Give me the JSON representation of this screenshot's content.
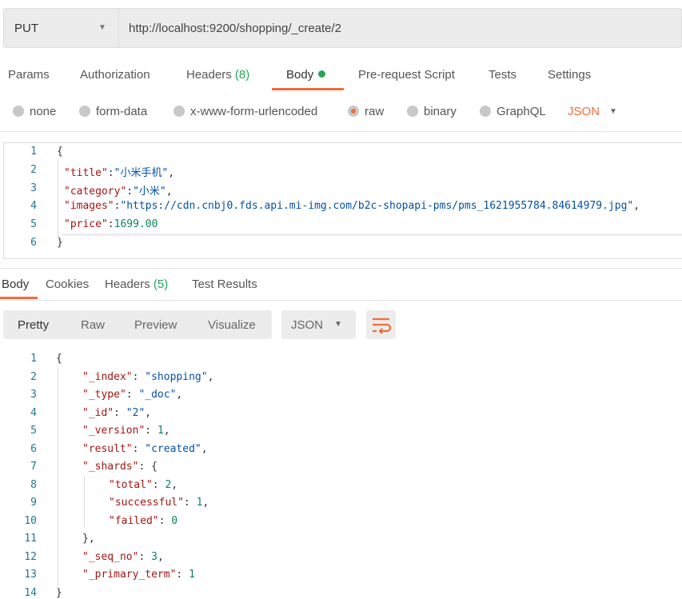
{
  "request": {
    "method": "PUT",
    "url": "http://localhost:9200/shopping/_create/2"
  },
  "req_tabs": [
    {
      "label": "Params"
    },
    {
      "label": "Authorization"
    },
    {
      "label": "Headers",
      "count": "(8)"
    },
    {
      "label": "Body",
      "active": true
    },
    {
      "label": "Pre-request Script"
    },
    {
      "label": "Tests"
    },
    {
      "label": "Settings"
    }
  ],
  "body_types": [
    {
      "label": "none"
    },
    {
      "label": "form-data"
    },
    {
      "label": "x-www-form-urlencoded"
    },
    {
      "label": "raw",
      "selected": true
    },
    {
      "label": "binary"
    },
    {
      "label": "GraphQL"
    }
  ],
  "body_format": "JSON",
  "request_body": [
    {
      "indent": 0,
      "tokens": [
        [
          "{",
          "p"
        ]
      ]
    },
    {
      "indent": 1,
      "tokens": [
        [
          "\"title\"",
          "k"
        ],
        [
          ":",
          "p"
        ],
        [
          "\"小米手机\"",
          "s"
        ],
        [
          ",",
          "p"
        ]
      ]
    },
    {
      "indent": 1,
      "tokens": [
        [
          "\"category\"",
          "k"
        ],
        [
          ":",
          "p"
        ],
        [
          "\"小米\"",
          "s"
        ],
        [
          ",",
          "p"
        ]
      ]
    },
    {
      "indent": 1,
      "tokens": [
        [
          "\"images\"",
          "k"
        ],
        [
          ":",
          "p"
        ],
        [
          "\"https://cdn.cnbj0.fds.api.mi-img.com/b2c-shopapi-pms/pms_1621955784.84614979.jpg\"",
          "s"
        ],
        [
          ",",
          "p"
        ]
      ]
    },
    {
      "indent": 1,
      "tokens": [
        [
          "\"price\"",
          "k"
        ],
        [
          ":",
          "p"
        ],
        [
          "1699.00",
          "n"
        ]
      ]
    },
    {
      "indent": 0,
      "tokens": [
        [
          "}",
          "p"
        ]
      ]
    }
  ],
  "resp_tabs": [
    {
      "label": "Body",
      "active": true
    },
    {
      "label": "Cookies"
    },
    {
      "label": "Headers",
      "count": "(5)"
    },
    {
      "label": "Test Results"
    }
  ],
  "view_modes": [
    "Pretty",
    "Raw",
    "Preview",
    "Visualize"
  ],
  "resp_format": "JSON",
  "wrap_icon": "wrap-lines-icon",
  "response_body": [
    {
      "indent": 0,
      "tokens": [
        [
          "{",
          "p"
        ]
      ]
    },
    {
      "indent": 1,
      "tokens": [
        [
          "\"_index\"",
          "k"
        ],
        [
          ": ",
          "p"
        ],
        [
          "\"shopping\"",
          "s"
        ],
        [
          ",",
          "p"
        ]
      ]
    },
    {
      "indent": 1,
      "tokens": [
        [
          "\"_type\"",
          "k"
        ],
        [
          ": ",
          "p"
        ],
        [
          "\"_doc\"",
          "s"
        ],
        [
          ",",
          "p"
        ]
      ]
    },
    {
      "indent": 1,
      "tokens": [
        [
          "\"_id\"",
          "k"
        ],
        [
          ": ",
          "p"
        ],
        [
          "\"2\"",
          "s"
        ],
        [
          ",",
          "p"
        ]
      ]
    },
    {
      "indent": 1,
      "tokens": [
        [
          "\"_version\"",
          "k"
        ],
        [
          ": ",
          "p"
        ],
        [
          "1",
          "n"
        ],
        [
          ",",
          "p"
        ]
      ]
    },
    {
      "indent": 1,
      "tokens": [
        [
          "\"result\"",
          "k"
        ],
        [
          ": ",
          "p"
        ],
        [
          "\"created\"",
          "s"
        ],
        [
          ",",
          "p"
        ]
      ]
    },
    {
      "indent": 1,
      "tokens": [
        [
          "\"_shards\"",
          "k"
        ],
        [
          ": {",
          "p"
        ]
      ]
    },
    {
      "indent": 2,
      "tokens": [
        [
          "\"total\"",
          "k"
        ],
        [
          ": ",
          "p"
        ],
        [
          "2",
          "n"
        ],
        [
          ",",
          "p"
        ]
      ]
    },
    {
      "indent": 2,
      "tokens": [
        [
          "\"successful\"",
          "k"
        ],
        [
          ": ",
          "p"
        ],
        [
          "1",
          "n"
        ],
        [
          ",",
          "p"
        ]
      ]
    },
    {
      "indent": 2,
      "tokens": [
        [
          "\"failed\"",
          "k"
        ],
        [
          ": ",
          "p"
        ],
        [
          "0",
          "n"
        ]
      ]
    },
    {
      "indent": 1,
      "tokens": [
        [
          "},",
          "p"
        ]
      ]
    },
    {
      "indent": 1,
      "tokens": [
        [
          "\"_seq_no\"",
          "k"
        ],
        [
          ": ",
          "p"
        ],
        [
          "3",
          "n"
        ],
        [
          ",",
          "p"
        ]
      ]
    },
    {
      "indent": 1,
      "tokens": [
        [
          "\"_primary_term\"",
          "k"
        ],
        [
          ": ",
          "p"
        ],
        [
          "1",
          "n"
        ]
      ]
    },
    {
      "indent": 0,
      "tokens": [
        [
          "}",
          "p"
        ]
      ]
    }
  ],
  "colors": {
    "accent": "#f26b3a",
    "green": "#26a657",
    "key": "#a31515",
    "string": "#0451a5",
    "number": "#098658",
    "line_number": "#237893"
  }
}
